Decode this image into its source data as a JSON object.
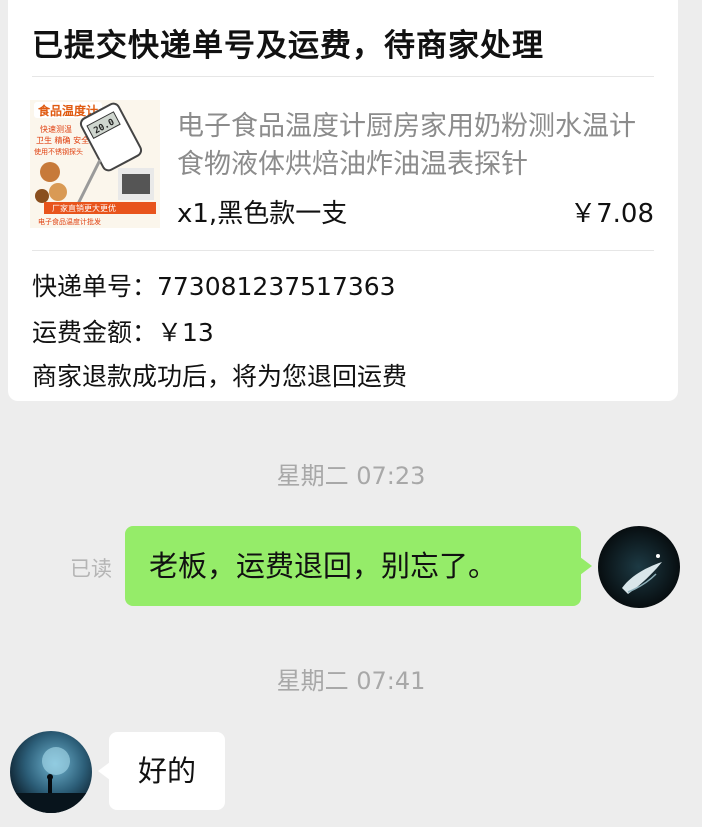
{
  "order_card": {
    "title": "已提交快递单号及运费，待商家处理",
    "product": {
      "image_label": "食品温度计",
      "image_lines": [
        "快速测温",
        "卫生 精确 安全",
        "使用不锈钢探头"
      ],
      "image_banner": "厂家直销更大更优",
      "image_footer": "电子食品温度计批发",
      "image_lcd": "20.0",
      "name": "电子食品温度计厨房家用奶粉测水温计食物液体烘焙油炸油温表探针",
      "spec": "x1,黑色款一支",
      "price": "￥7.08"
    },
    "tracking": "快递单号：773081237517363",
    "shipping_fee": "运费金额：￥13",
    "note": "商家退款成功后，将为您退回运费"
  },
  "chat": {
    "time_1": "星期二 07:23",
    "read_status": "已读",
    "message_me": "老板，运费退回，别忘了。",
    "time_2": "星期二 07:41",
    "message_other": "好的"
  },
  "colors": {
    "background": "#ededed",
    "my_bubble": "#95ec69",
    "other_bubble": "#ffffff",
    "timestamp": "#a8a8a8"
  }
}
